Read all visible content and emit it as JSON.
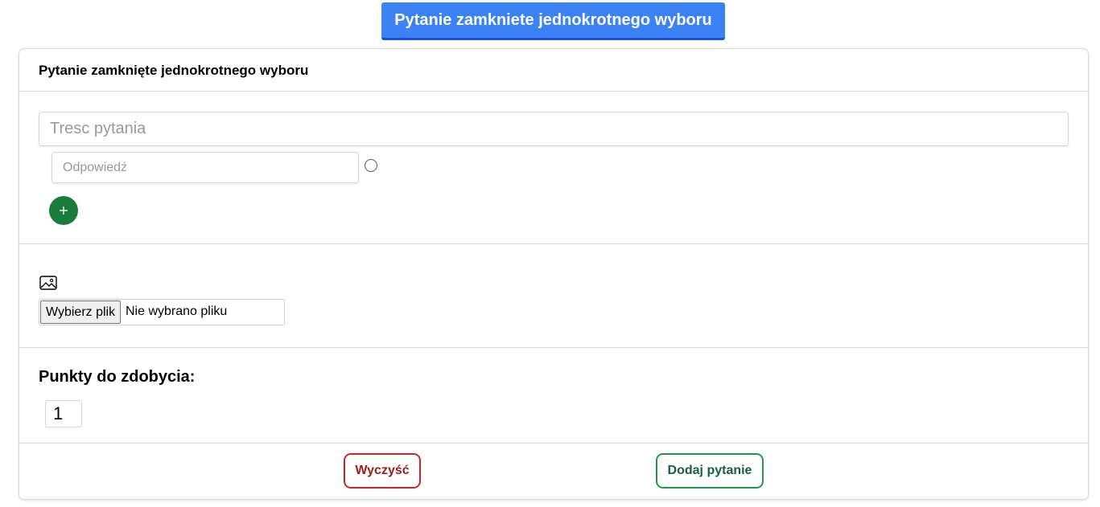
{
  "header": {
    "type_button_label": "Pytanie zamkniete jednokrotnego wyboru"
  },
  "card": {
    "title": "Pytanie zamknięte jednokrotnego wyboru",
    "question": {
      "placeholder": "Tresc pytania",
      "value": ""
    },
    "answers": [
      {
        "placeholder": "Odpowiedź",
        "value": "",
        "selected": false
      }
    ],
    "add_answer_icon": "plus-icon",
    "image": {
      "icon": "image-icon",
      "file_button_label": "Wybierz plik",
      "file_status": "Nie wybrano pliku"
    },
    "points": {
      "label": "Punkty do zdobycia:",
      "value": "1"
    },
    "actions": {
      "clear_label": "Wyczyść",
      "submit_label": "Dodaj pytanie"
    }
  },
  "colors": {
    "primary": "#3b82f6",
    "add_button": "#197b3c",
    "danger": "#c62828",
    "success": "#1e9a4a"
  }
}
